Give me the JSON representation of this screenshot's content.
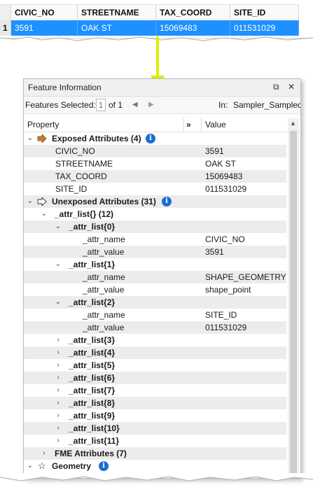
{
  "table": {
    "row_number": "1",
    "columns": [
      "CIVIC_NO",
      "STREETNAME",
      "TAX_COORD",
      "SITE_ID"
    ],
    "selected_row": [
      "3591",
      "OAK ST",
      "15069483",
      "011531029"
    ]
  },
  "panel": {
    "title": "Feature Information",
    "restore_icon": "restore-window-icon",
    "close_label": "✕",
    "features_selected_label": "Features Selected:",
    "features_selected_value": "1",
    "of_label": "of 1",
    "in_label": "In:",
    "in_value": "Sampler_Sampled"
  },
  "columns": {
    "property": "Property",
    "expand": "»",
    "value": "Value"
  },
  "tree": {
    "exposed": "Exposed Attributes (4)",
    "civic_no": {
      "name": "CIVIC_NO",
      "value": "3591"
    },
    "streetname": {
      "name": "STREETNAME",
      "value": "OAK ST"
    },
    "tax_coord": {
      "name": "TAX_COORD",
      "value": "15069483"
    },
    "site_id": {
      "name": "SITE_ID",
      "value": "011531029"
    },
    "unexposed": "Unexposed Attributes (31)",
    "attr_list": "_attr_list{} (12)",
    "l0": "_attr_list{0}",
    "l0_name": {
      "name": "_attr_name",
      "value": "CIVIC_NO"
    },
    "l0_value": {
      "name": "_attr_value",
      "value": "3591"
    },
    "l1": "_attr_list{1}",
    "l1_name": {
      "name": "_attr_name",
      "value": "SHAPE_GEOMETRY"
    },
    "l1_value": {
      "name": "_attr_value",
      "value": "shape_point"
    },
    "l2": "_attr_list{2}",
    "l2_name": {
      "name": "_attr_name",
      "value": "SITE_ID"
    },
    "l2_value": {
      "name": "_attr_value",
      "value": "011531029"
    },
    "l3": "_attr_list{3}",
    "l4": "_attr_list{4}",
    "l5": "_attr_list{5}",
    "l6": "_attr_list{6}",
    "l7": "_attr_list{7}",
    "l8": "_attr_list{8}",
    "l9": "_attr_list{9}",
    "l10": "_attr_list{10}",
    "l11": "_attr_list{11}",
    "fme": "FME Attributes (7)",
    "geometry": "Geometry"
  },
  "colors": {
    "selection": "#1e90ff",
    "info_icon": "#1b6fcf",
    "arrow": "#d8f000"
  }
}
